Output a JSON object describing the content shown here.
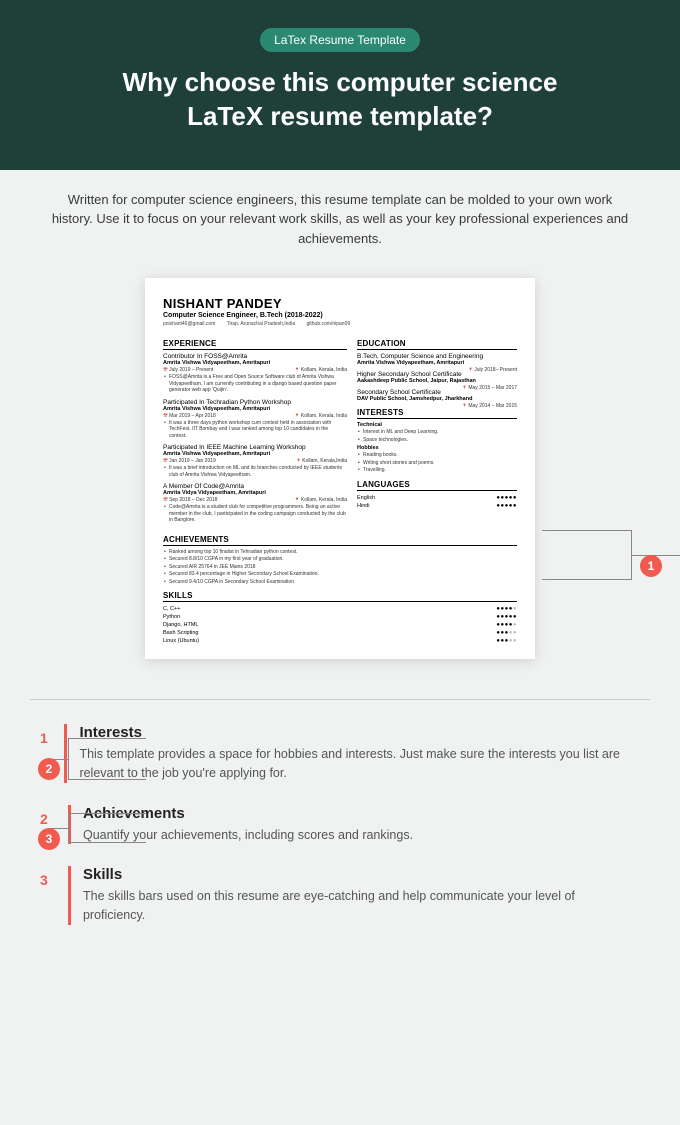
{
  "header": {
    "badge": "LaTex Resume Template",
    "title_line1": "Why choose this computer science",
    "title_line2": "LaTeX resume template?"
  },
  "intro": "Written for computer science engineers, this resume template can be molded to your own work history. Use it to focus on your relevant work skills, as well as your key professional experiences and achievements.",
  "resume": {
    "name": "NISHANT PANDEY",
    "subtitle": "Computer Science Engineer, B.Tech (2018-2022)",
    "contact": {
      "email": "pnishant46@gmail.com",
      "location": "Tirap, Arunachal Pradesh,India",
      "github": "github.com/nipan09"
    },
    "sections": {
      "experience": "EXPERIENCE",
      "education": "EDUCATION",
      "interests": "INTERESTS",
      "languages": "LANGUAGES",
      "achievements": "ACHIEVEMENTS",
      "skills": "SKILLS"
    },
    "experience": [
      {
        "title": "Contributor In FOSS@Amrita",
        "sub": "Amrita Vishwa Vidyapeetham, Amritapuri",
        "date": "July 2019 – Present",
        "loc": "Kollam, Kerala, India",
        "bullet": "FOSS@Amrita is a Free and Open Source Software club of Amrita Vishwa Vidyapeetham. I am currently contributing in a django based question paper generator web app 'Quijin'."
      },
      {
        "title": "Participated In Techradian Python Workshop",
        "sub": "Amrita Vishwa Vidyapeetham, Amritapuri",
        "date": "Mar 2019 – Apr 2018",
        "loc": "Kollam, Kerala, India",
        "bullet": "It was a three days python workshop cum contest held in association with TechFest, IIT Bombay and I was ranked among top 10 candidates in the contest."
      },
      {
        "title": "Participated In IEEE Machine Learning Workshop",
        "sub": "Amrita Vishwa Vidyapeetham, Amritapuri",
        "date": "Jan 2019 – Jan 2019",
        "loc": "Kollam, Kerala,India",
        "bullet": "It was a brief introduction on ML and its branches conducted by IEEE students club of Amrita Vishwa Vidyapeetham."
      },
      {
        "title": "A Member Of Code@Amrita",
        "sub": "Amrita Vidya Vidyapeetham, Amritapuri",
        "date": "Sep 2018 – Dec 2018",
        "loc": "Kollam, Kerala, India",
        "bullet": "Code@Amrita is a student club for competitive programmers. Being an active member in the club, I participated in the coding campaign conducted by the club in Banglore."
      }
    ],
    "education": [
      {
        "title": "B.Tech, Computer Science and Engineering",
        "sub": "Amrita Vishwa Vidyapeetham, Amritapuri",
        "date": "July 2018– Present"
      },
      {
        "title": "Higher Secondary School Certificate",
        "sub": "Aakashdeep Public School, Jaipur, Rajasthan",
        "date": "May 2015 – Mar 2017"
      },
      {
        "title": "Secondary School Certificate",
        "sub": "DAV Public School, Jamshedpur, Jharkhand",
        "date": "May 2014 – Mar 2015"
      }
    ],
    "interests": {
      "technical_label": "Technical",
      "technical": [
        "Interest in ML and Deep Learning.",
        "Space technologies."
      ],
      "hobbies_label": "Hobbies",
      "hobbies": [
        "Reading books.",
        "Writing short stories and poems.",
        "Travelling."
      ]
    },
    "languages": [
      {
        "name": "English",
        "dots": "●●●●●"
      },
      {
        "name": "Hindi",
        "dots": "●●●●●"
      }
    ],
    "achievements": [
      "Ranked among top 10 finalist in Tehradian python contest.",
      "Secured 8.8/10 CGPA in my first year of graduation.",
      "Secured AIR 25764 in JEE Mains 2018",
      "Secured 83.4 percentage in Higher Secondary School Examination.",
      "Secured 9.4/10 CGPA in Secondary School Examination."
    ],
    "skills": [
      {
        "name": "C, C++",
        "level": 4
      },
      {
        "name": "Python",
        "level": 5
      },
      {
        "name": "Django, HTML",
        "level": 4
      },
      {
        "name": "Bash Scripting",
        "level": 3
      },
      {
        "name": "Linux (Ubuntu)",
        "level": 3
      }
    ]
  },
  "callouts": {
    "c1": "1",
    "c2": "2",
    "c3": "3"
  },
  "explains": [
    {
      "num": "1",
      "title": "Interests",
      "text": "This template provides a space for hobbies and interests. Just make sure the interests you list are relevant to the job you're applying for."
    },
    {
      "num": "2",
      "title": "Achievements",
      "text": "Quantify your achievements, including scores and rankings."
    },
    {
      "num": "3",
      "title": "Skills",
      "text": "The skills bars used on this resume are eye-catching and help communicate your level of proficiency."
    }
  ]
}
